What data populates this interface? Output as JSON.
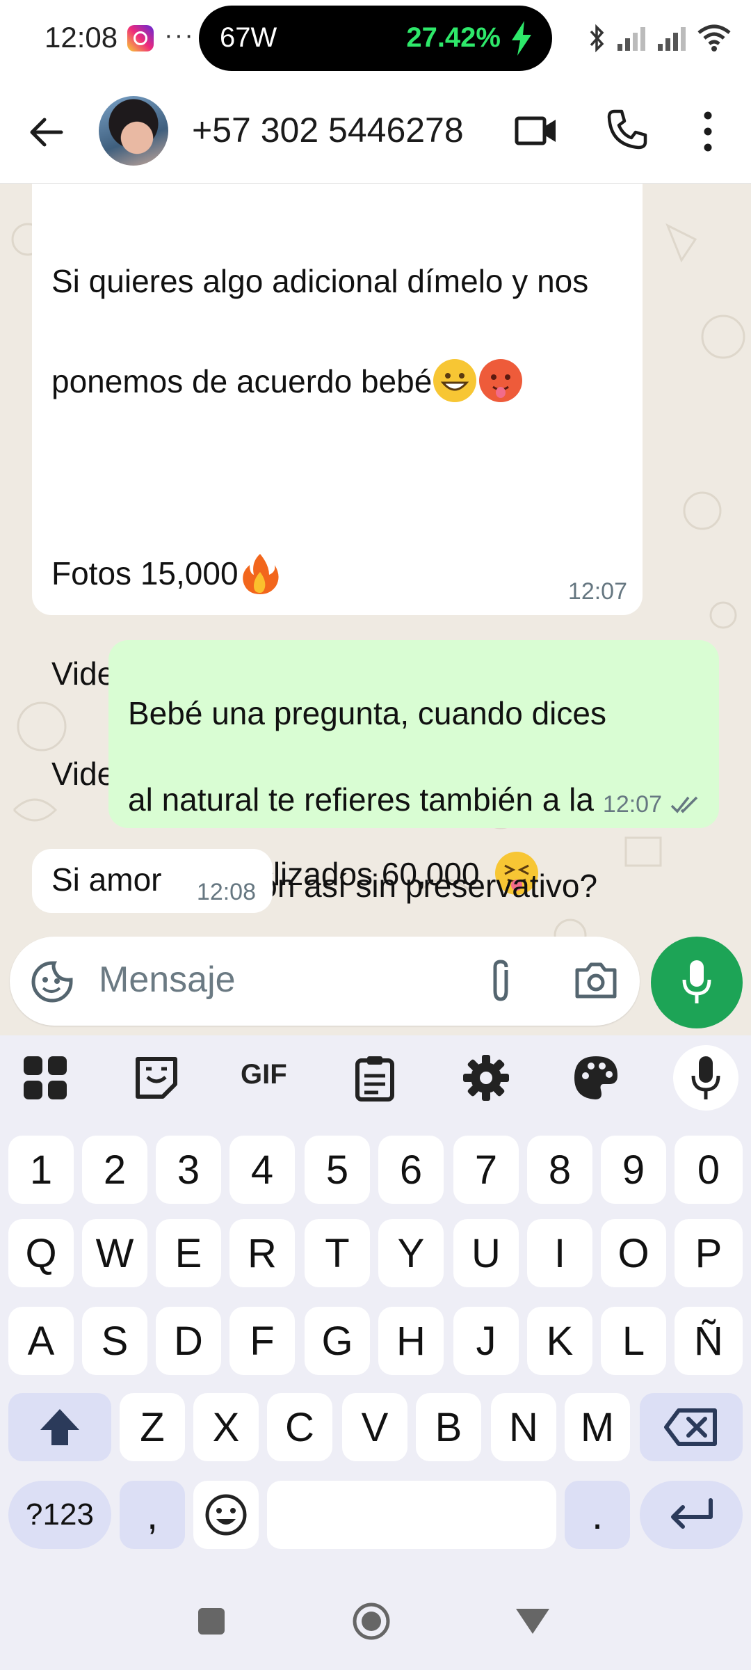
{
  "status_bar": {
    "time": "12:08",
    "notif_icon": "instagram-icon",
    "more_indicator": "···",
    "charging_watts": "67W",
    "battery_percent": "27.42%",
    "icons": [
      "bluetooth-icon",
      "signal-icon",
      "signal-icon",
      "wifi-icon"
    ]
  },
  "header": {
    "contact_name": "+57 302 5446278",
    "icons": [
      "back-arrow-icon",
      "video-call-icon",
      "phone-icon",
      "more-vert-icon"
    ]
  },
  "messages": [
    {
      "direction": "in",
      "lines": [
        "Si quieres algo adicional dímelo y nos",
        "ponemos de acuerdo bebé"
      ],
      "price_list": [
        "Fotos 15,000",
        "Videos 40,000",
        "Videos en pareja 70.000",
        "Videos personalizados 60,000 "
      ],
      "time": "12:07"
    },
    {
      "direction": "out",
      "lines": [
        "Bebé una pregunta, cuando dices",
        "al natural te refieres también a la",
        "penetración así sin preservativo?"
      ],
      "time": "12:07",
      "status": "read"
    },
    {
      "direction": "in",
      "text": "Si amor",
      "time": "12:08"
    }
  ],
  "composer": {
    "placeholder": "Mensaje",
    "icons": [
      "sticker-icon",
      "attach-icon",
      "camera-icon",
      "mic-icon"
    ]
  },
  "keyboard": {
    "toolbar": [
      "apps-grid-icon",
      "sticker-icon",
      "GIF",
      "clipboard-icon",
      "settings-gear-icon",
      "palette-icon",
      "mic-icon"
    ],
    "row_numbers": [
      "1",
      "2",
      "3",
      "4",
      "5",
      "6",
      "7",
      "8",
      "9",
      "0"
    ],
    "row_1": [
      "Q",
      "W",
      "E",
      "R",
      "T",
      "Y",
      "U",
      "I",
      "O",
      "P"
    ],
    "row_2": [
      "A",
      "S",
      "D",
      "F",
      "G",
      "H",
      "J",
      "K",
      "L",
      "Ñ"
    ],
    "row_3": [
      "Z",
      "X",
      "C",
      "V",
      "B",
      "N",
      "M"
    ],
    "row_4": {
      "symbols": "?123",
      "comma": ",",
      "period": "."
    },
    "special_icons": [
      "shift-icon",
      "backspace-icon",
      "emoji-icon",
      "enter-icon"
    ]
  },
  "nav_bar": {
    "icons": [
      "recents-square-icon",
      "home-circle-icon",
      "back-triangle-icon"
    ]
  },
  "colors": {
    "accent": "#1da456",
    "outgoing_bubble": "#d9fdd3",
    "chat_bg": "#efeae2",
    "battery_text": "#2ee86a"
  }
}
